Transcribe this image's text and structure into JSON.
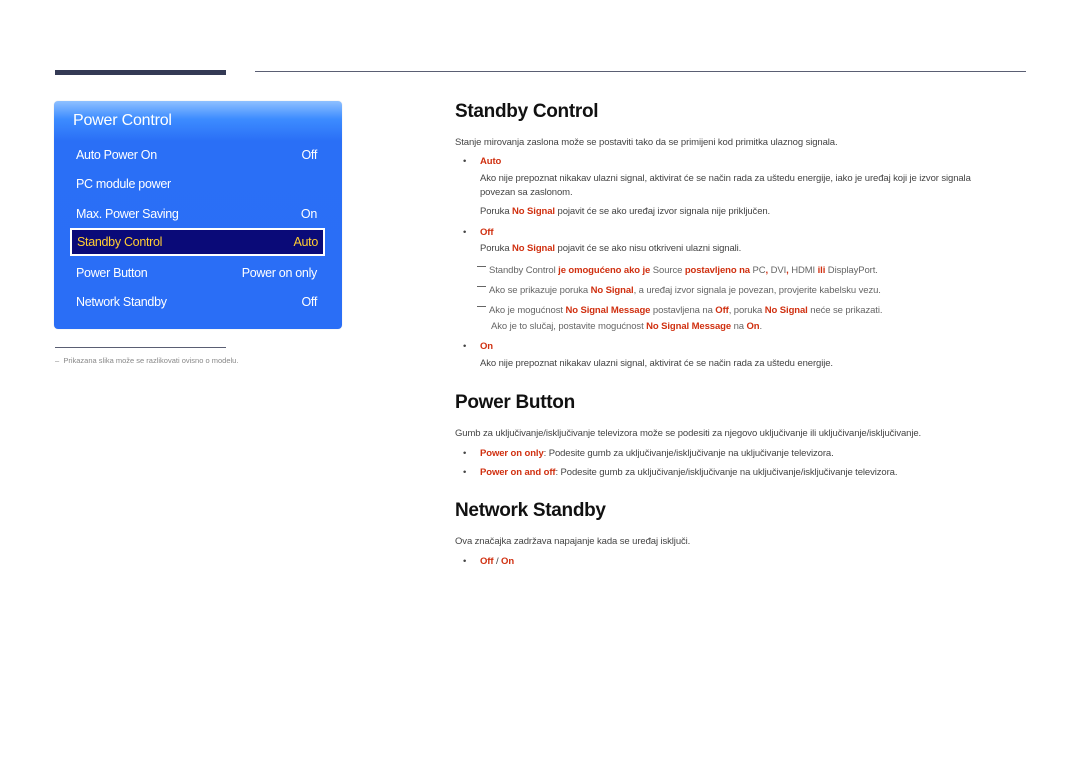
{
  "menu": {
    "title": "Power Control",
    "items": [
      {
        "label": "Auto Power On",
        "value": "Off"
      },
      {
        "label": "PC module power",
        "value": ""
      },
      {
        "label": "Max. Power Saving",
        "value": "On"
      },
      {
        "label": "Standby Control",
        "value": "Auto",
        "selected": true
      },
      {
        "label": "Power Button",
        "value": "Power on only"
      },
      {
        "label": "Network Standby",
        "value": "Off"
      }
    ]
  },
  "footnote": "Prikazana slika može se razlikovati ovisno o modelu.",
  "footnote_dash": "–",
  "bullet": "•",
  "standby": {
    "title": "Standby Control",
    "intro": "Stanje mirovanja zaslona može se postaviti tako da se primijeni kod primitka ulaznog signala.",
    "auto_label": "Auto",
    "auto_line1": "Ako nije prepoznat nikakav ulazni signal, aktivirat će se način rada za uštedu energije, iako je uređaj koji je izvor signala",
    "auto_line2": "povezan sa zaslonom.",
    "auto_msg_pre": "Poruka ",
    "no_signal": "No Signal",
    "auto_msg_post": " pojavit će se ako uređaj izvor signala nije priključen.",
    "off_label": "Off",
    "off_msg_pre": "Poruka ",
    "off_msg_post": " pojavit će se ako nisu otkriveni ulazni signali.",
    "note1": {
      "a": "Standby Control ",
      "b": "je omogućeno ako je",
      "c": " Source ",
      "d": "postavljeno na",
      "e": " PC",
      "f": ",",
      "g": " DVI",
      "h": ",",
      "i": " HDMI ",
      "j": "ili",
      "k": " DisplayPort."
    },
    "note2": {
      "pre": "Ako se prikazuje poruka ",
      "hl": "No Signal",
      "post": ", a uređaj izvor signala je povezan, provjerite kabelsku vezu."
    },
    "note3": {
      "a": "Ako je mogućnost ",
      "b": "No Signal Message",
      "c": " postavljena na ",
      "d": "Off",
      "e": ", poruka ",
      "f": "No Signal",
      "g": " neće se prikazati.",
      "h": "Ako je to slučaj, postavite mogućnost ",
      "i": "No Signal Message",
      "j": " na ",
      "k": "On",
      "l": "."
    },
    "on_label": "On",
    "on_text": "Ako nije prepoznat nikakav ulazni signal, aktivirat će se način rada za uštedu energije."
  },
  "power_button": {
    "title": "Power Button",
    "intro": "Gumb za uključivanje/isključivanje televizora može se podesiti za njegovo uključivanje ili uključivanje/isključivanje.",
    "opt1_label": "Power on only",
    "opt1_text": ": Podesite gumb za uključivanje/isključivanje na uključivanje televizora.",
    "opt2_label": "Power on and off",
    "opt2_text": ": Podesite gumb za uključivanje/isključivanje na uključivanje/isključivanje televizora."
  },
  "network_standby": {
    "title": "Network Standby",
    "intro": "Ova značajka zadržava napajanje kada se uređaj isključi.",
    "opt_off": "Off",
    "opt_sep": " / ",
    "opt_on": "On"
  }
}
